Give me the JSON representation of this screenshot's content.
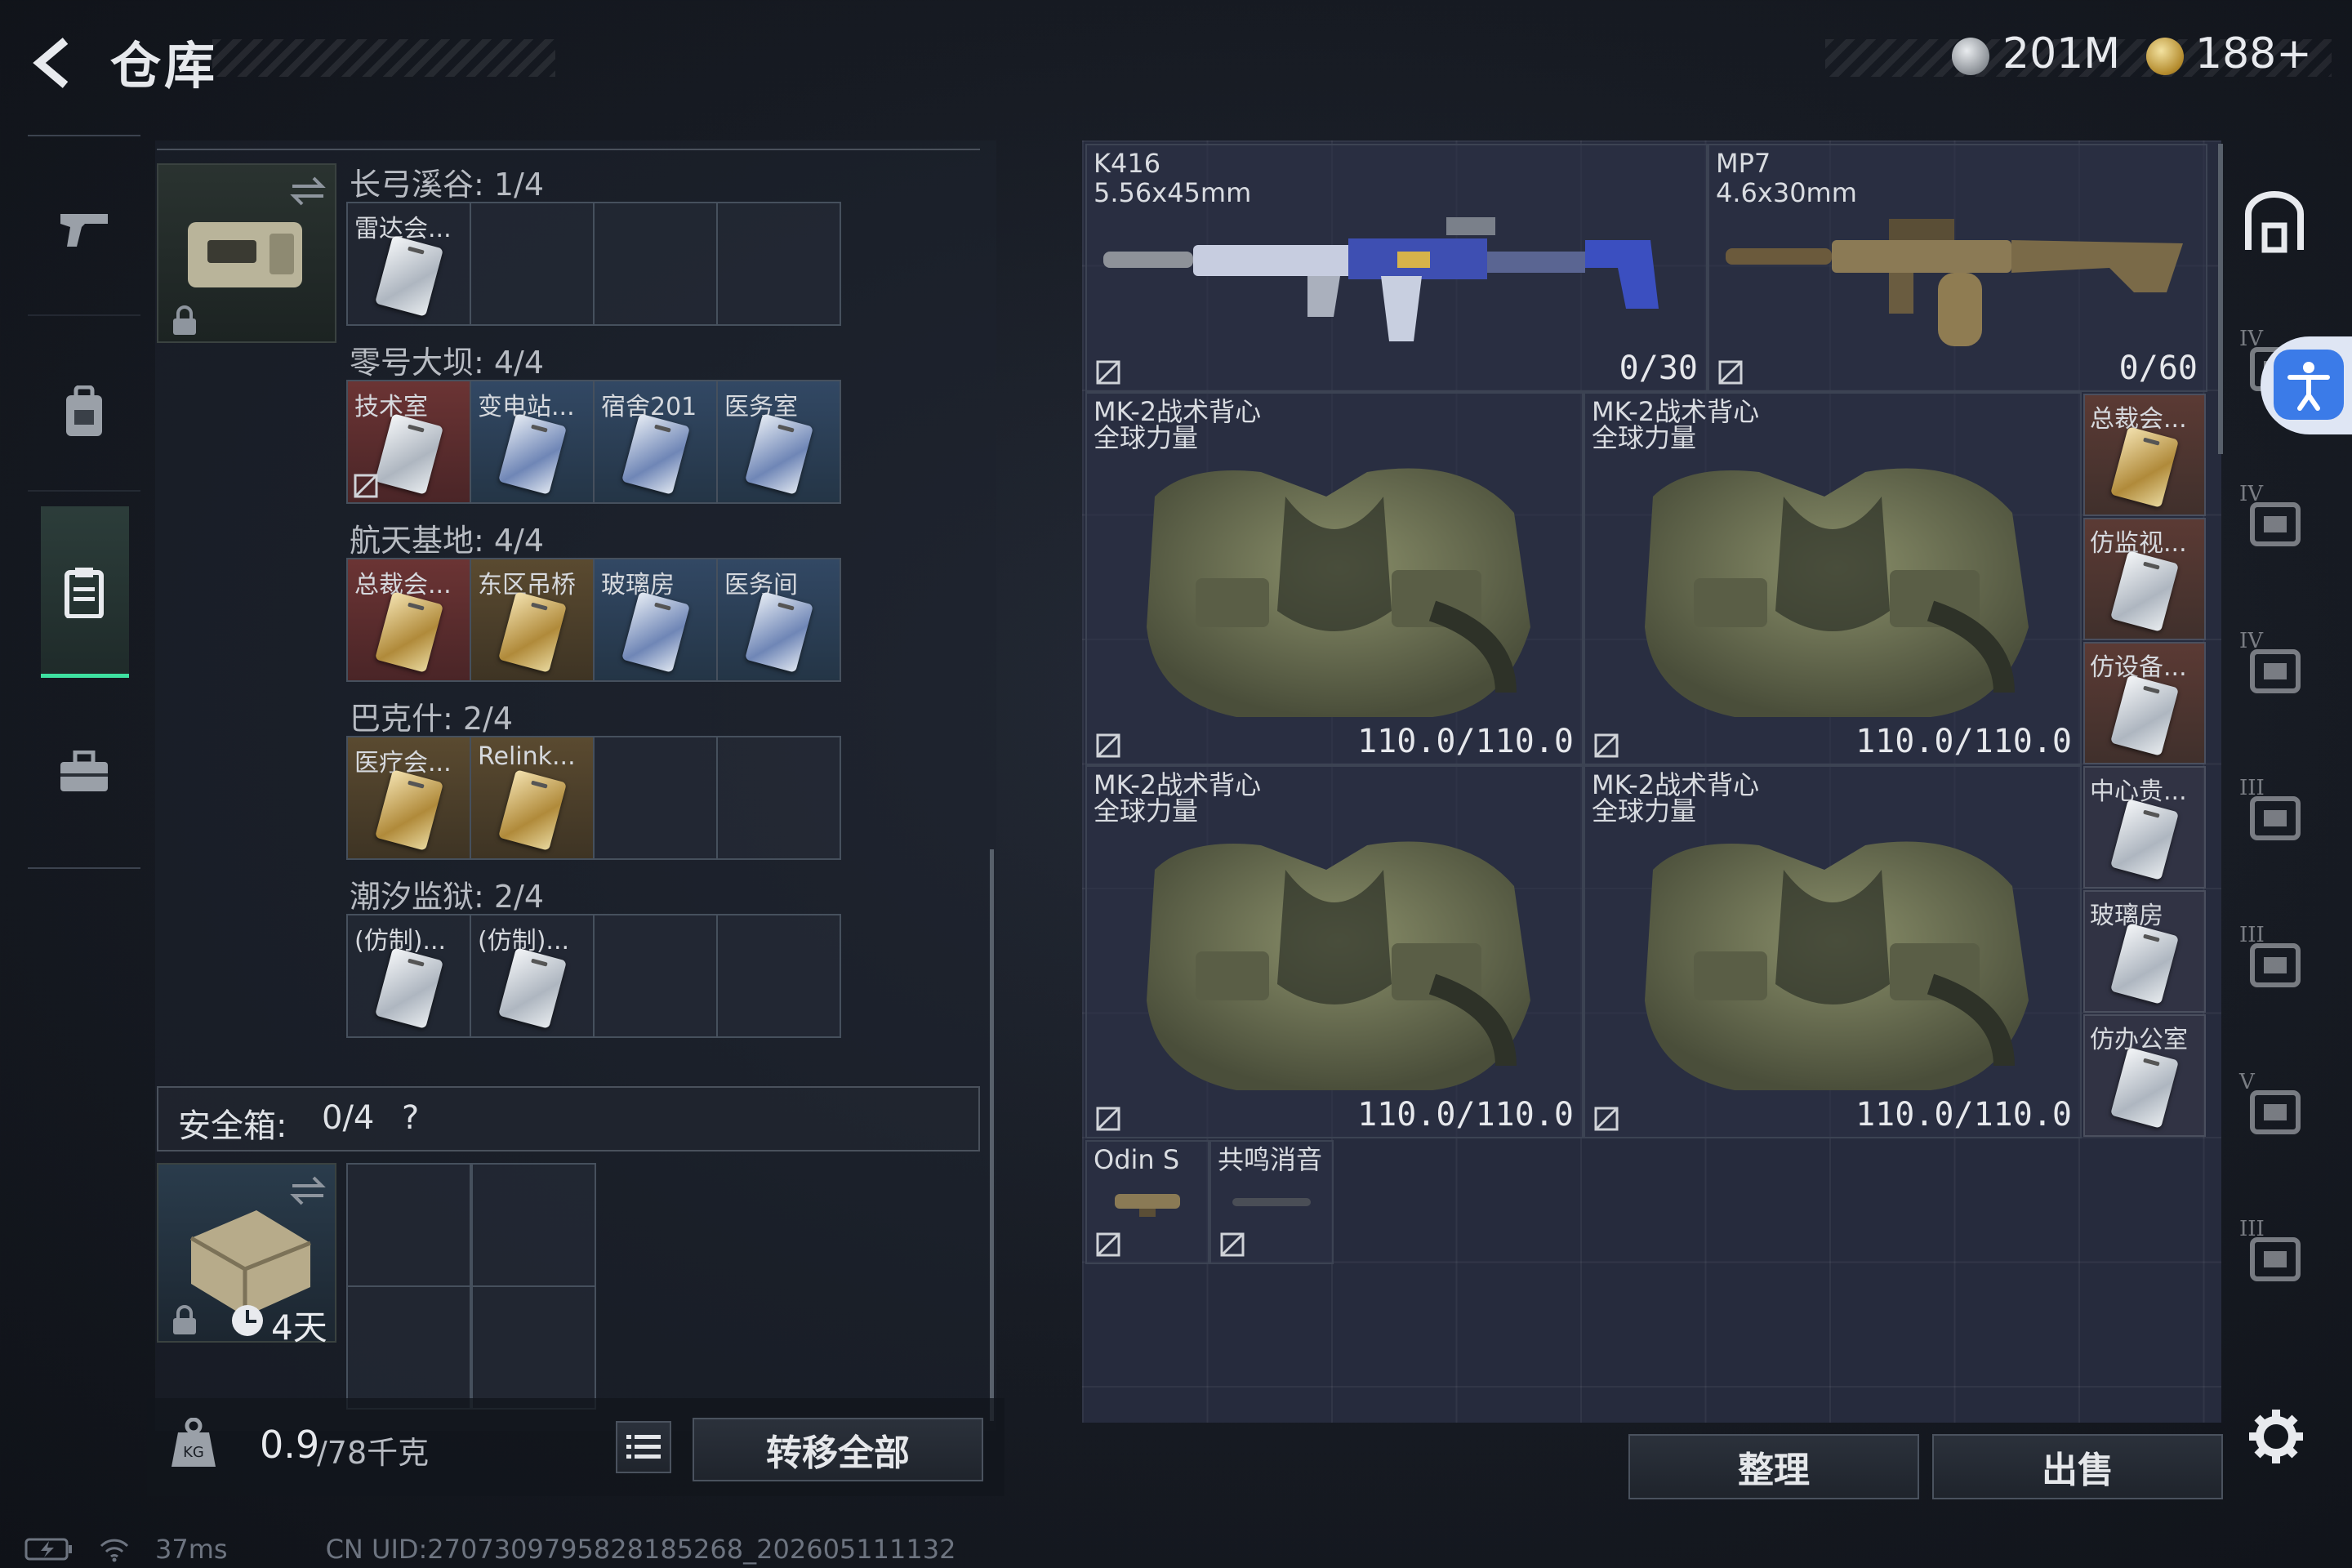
{
  "header": {
    "title": "仓库"
  },
  "currency": {
    "coins": "201M",
    "tokens": "188+"
  },
  "nav": {
    "items": [
      "weapons",
      "backpack",
      "storage",
      "toolbox"
    ]
  },
  "left": {
    "groups": [
      {
        "label": "长弓溪谷: 1/4",
        "cells": [
          {
            "name": "雷达会...",
            "style": "plain"
          },
          null,
          null,
          null
        ]
      },
      {
        "label": "零号大坝: 4/4",
        "cells": [
          {
            "name": "技术室",
            "style": "red"
          },
          {
            "name": "变电站...",
            "style": "blue"
          },
          {
            "name": "宿舍201",
            "style": "blue"
          },
          {
            "name": "医务室",
            "style": "blue"
          }
        ]
      },
      {
        "label": "航天基地: 4/4",
        "cells": [
          {
            "name": "总裁会...",
            "style": "red"
          },
          {
            "name": "东区吊桥",
            "style": "gold"
          },
          {
            "name": "玻璃房",
            "style": "blue"
          },
          {
            "name": "医务间",
            "style": "blue"
          }
        ]
      },
      {
        "label": "巴克什: 2/4",
        "cells": [
          {
            "name": "医疗会...",
            "style": "gold"
          },
          {
            "name": "Relink...",
            "style": "gold"
          },
          null,
          null
        ]
      },
      {
        "label": "潮汐监狱: 2/4",
        "cells": [
          {
            "name": "(仿制)...",
            "style": "plain"
          },
          {
            "name": "(仿制)...",
            "style": "plain"
          },
          null,
          null
        ]
      }
    ],
    "safe_box": {
      "label": "安全箱:",
      "count": "0/4",
      "help": "?",
      "timer": "4天"
    },
    "weight": {
      "value": "0.9",
      "max": "/78千克"
    },
    "transfer_all": "转移全部"
  },
  "right": {
    "weapons": [
      {
        "name": "K416",
        "caliber": "5.56x45mm",
        "ammo": "0/30"
      },
      {
        "name": "MP7",
        "caliber": "4.6x30mm",
        "ammo": "0/60"
      }
    ],
    "vests": [
      {
        "name": "MK-2战术背心",
        "sub": "全球力量",
        "durability": "110.0/110.0"
      },
      {
        "name": "MK-2战术背心",
        "sub": "全球力量",
        "durability": "110.0/110.0"
      },
      {
        "name": "MK-2战术背心",
        "sub": "全球力量",
        "durability": "110.0/110.0"
      },
      {
        "name": "MK-2战术背心",
        "sub": "全球力量",
        "durability": "110.0/110.0"
      }
    ],
    "side_keys": [
      "总裁会...",
      "仿监视...",
      "仿设备...",
      "中心贵...",
      "玻璃房",
      "仿办公室"
    ],
    "attachments": [
      {
        "name": "Odin S"
      },
      {
        "name": "共鸣消音"
      }
    ],
    "sort_button": "整理",
    "sell_button": "出售"
  },
  "rail": {
    "labels": [
      "IV",
      "IV",
      "IV",
      "III",
      "III",
      "V",
      "III"
    ]
  },
  "status": {
    "ping": "37ms",
    "uid": "CN UID:2707309795828185268_202605111132"
  },
  "colors": {
    "accent": "#3ee0a0",
    "panel": "#262b3d",
    "red_cell": "#6b3434",
    "blue_cell": "#324864"
  }
}
